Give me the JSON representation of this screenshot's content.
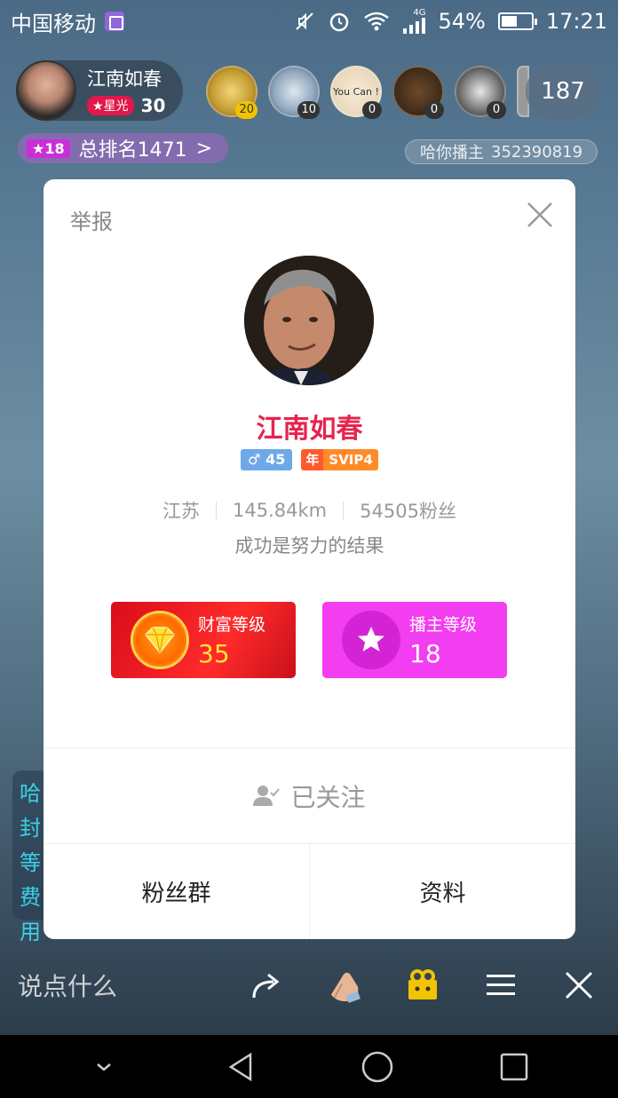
{
  "status_bar": {
    "carrier": "中国移动",
    "network": "4G",
    "battery": "54%",
    "battery_level": 0.54,
    "time": "17:21"
  },
  "host": {
    "name": "江南如春",
    "badge": "星光",
    "score": "30"
  },
  "viewers": [
    {
      "count": "20"
    },
    {
      "count": "10"
    },
    {
      "label": "You Can !",
      "count": "0"
    },
    {
      "count": "0"
    },
    {
      "count": "0"
    }
  ],
  "viewer_total": "187",
  "rank": {
    "level": "18",
    "text": "总排名1471",
    "arrow": ">"
  },
  "room_id": {
    "label": "哈你播主",
    "id": "352390819"
  },
  "side_text": [
    "哈",
    "封",
    "等",
    "费",
    "用"
  ],
  "dialog": {
    "report": "举报",
    "name": "江南如春",
    "gender_age": "♂ 45",
    "year_tag": "年",
    "svip": "SVIP4",
    "location": "江苏",
    "distance": "145.84km",
    "fans": "54505粉丝",
    "motto": "成功是努力的结果",
    "wealth_title": "财富等级",
    "wealth_value": "35",
    "anchor_title": "播主等级",
    "anchor_value": "18",
    "follow_label": "已关注",
    "fans_group": "粉丝群",
    "profile": "资料"
  },
  "bottom_bar": {
    "say": "说点什么"
  },
  "colors": {
    "name_red": "#e8234e",
    "wealth_red": "#e2141f",
    "anchor_pink": "#f33df0",
    "wealth_value_yellow": "#ffe23a"
  }
}
